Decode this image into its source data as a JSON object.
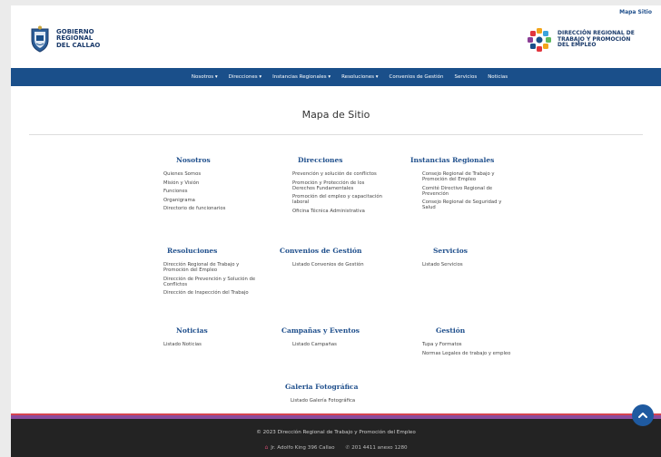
{
  "topbar": {
    "sitemap_link": "Mapa Sitio"
  },
  "header": {
    "gov_logo_text": [
      "GOBIERNO",
      "REGIONAL",
      "DEL CALLAO"
    ],
    "drtpe_logo_text": [
      "DIRECCIÓN REGIONAL DE",
      "TRABAJO Y PROMOCIÓN",
      "DEL EMPLEO"
    ]
  },
  "nav": {
    "items": [
      "Nosotros ▾",
      "Direcciones ▾",
      "Instancias Regionales ▾",
      "Resoluciones ▾",
      "Convenios de Gestión",
      "Servicios",
      "Noticias"
    ]
  },
  "page_title": "Mapa de Sitio",
  "sections": {
    "nosotros": {
      "title": "Nosotros",
      "links": [
        "Quienes Somos",
        "Misión y Visión",
        "Funciones",
        "Organigrama",
        "Directorio de funcionarios"
      ]
    },
    "direcciones": {
      "title": "Direcciones",
      "links": [
        "Prevención y solución de conflictos",
        "Promoción y Protección de los Derechos Fundamentales",
        "Promoción del empleo y capacitación laboral",
        "Oficina Técnica Administrativa"
      ]
    },
    "instancias": {
      "title": "Instancias Regionales",
      "links": [
        "Consejo Regional de Trabajo y Promoción del Empleo",
        "Comité Directivo Regional de Prevención",
        "Consejo Regional de Seguridad y Salud"
      ]
    },
    "resoluciones": {
      "title": "Resoluciones",
      "links": [
        "Dirección Regional de Trabajo y Promoción del Empleo",
        "Dirección de Prevención y Solución de Conflictos",
        "Dirección de Inspección del Trabajo"
      ]
    },
    "convenios": {
      "title": "Convenios de Gestión",
      "links": [
        "Listado Convenios de Gestión"
      ]
    },
    "servicios": {
      "title": "Servicios",
      "links": [
        "Listado Servicios"
      ]
    },
    "noticias": {
      "title": "Noticias",
      "links": [
        "Listado Noticias"
      ]
    },
    "campanas": {
      "title": "Campañas y Eventos",
      "links": [
        "Listado Campañas"
      ]
    },
    "gestion": {
      "title": "Gestión",
      "links": [
        "Tupa y Formatos",
        "Normas Legales de trabajo y empleo"
      ]
    },
    "galeria": {
      "title": "Galeria Fotográfica",
      "links": [
        "Listado Galería Fotográfica"
      ]
    }
  },
  "footer": {
    "copyright": "© 2023 Dirección Regional de Trabajo y Promoción del Empleo",
    "address": "Jr. Adolfo King 396 Callao",
    "phone": "201 4411 anexo 1280"
  },
  "colors": {
    "nav": "#1a4f8a",
    "accent": "#1f4f8c",
    "footer": "#232323",
    "stripe_red": "#d6444f",
    "stripe_purple": "#8a4c9e"
  }
}
